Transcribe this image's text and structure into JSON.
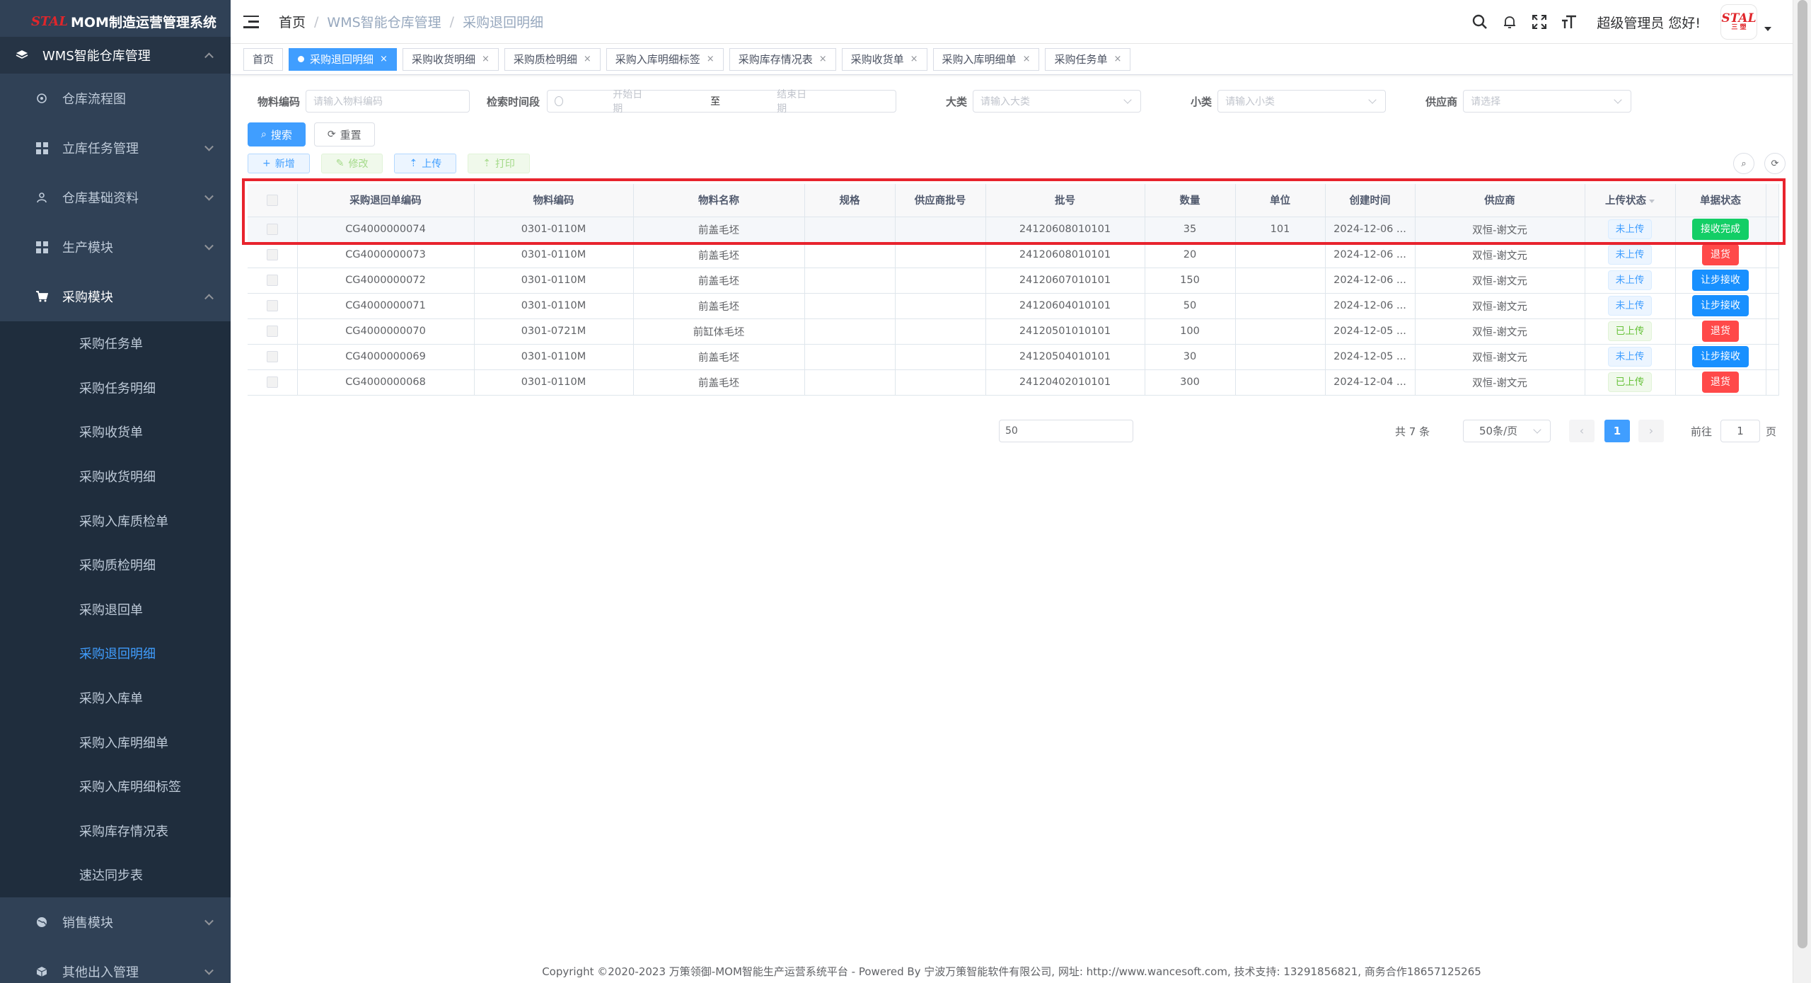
{
  "app": {
    "logo": "STAL",
    "title": "MOM制造运营管理系统"
  },
  "sidebar": {
    "top_group": "WMS智能仓库管理",
    "groups": [
      {
        "label": "仓库流程图"
      },
      {
        "label": "立库任务管理"
      },
      {
        "label": "仓库基础资料"
      },
      {
        "label": "生产模块"
      },
      {
        "label": "采购模块"
      }
    ],
    "purchase_items": [
      {
        "label": "采购任务单"
      },
      {
        "label": "采购任务明细"
      },
      {
        "label": "采购收货单"
      },
      {
        "label": "采购收货明细"
      },
      {
        "label": "采购入库质检单"
      },
      {
        "label": "采购质检明细"
      },
      {
        "label": "采购退回单"
      },
      {
        "label": "采购退回明细"
      },
      {
        "label": "采购入库单"
      },
      {
        "label": "采购入库明细单"
      },
      {
        "label": "采购入库明细标签"
      },
      {
        "label": "采购库存情况表"
      },
      {
        "label": "速达同步表"
      }
    ],
    "bottom_groups": [
      {
        "label": "销售模块"
      },
      {
        "label": "其他出入管理"
      }
    ]
  },
  "navbar": {
    "breadcrumb": [
      "首页",
      "WMS智能仓库管理",
      "采购退回明细"
    ],
    "greeting": "超级管理员 您好!",
    "avatar_text": "STAL",
    "avatar_sub": "三 塑"
  },
  "tags": [
    {
      "label": "首页"
    },
    {
      "label": "采购退回明细"
    },
    {
      "label": "采购收货明细"
    },
    {
      "label": "采购质检明细"
    },
    {
      "label": "采购入库明细标签"
    },
    {
      "label": "采购库存情况表"
    },
    {
      "label": "采购收货单"
    },
    {
      "label": "采购入库明细单"
    },
    {
      "label": "采购任务单"
    }
  ],
  "filters": {
    "material_code": {
      "label": "物料编码",
      "placeholder": "请输入物料编码"
    },
    "time_range": {
      "label": "检索时间段",
      "start": "开始日期",
      "to": "至",
      "end": "结束日期"
    },
    "major": {
      "label": "大类",
      "placeholder": "请输入大类"
    },
    "minor": {
      "label": "小类",
      "placeholder": "请输入小类"
    },
    "supplier": {
      "label": "供应商",
      "placeholder": "请选择"
    }
  },
  "buttons": {
    "search": "搜索",
    "reset": "重置",
    "add": "新增",
    "edit": "修改",
    "upload": "上传",
    "print": "打印"
  },
  "table": {
    "headers": [
      "采购退回单编码",
      "物料编码",
      "物料名称",
      "规格",
      "供应商批号",
      "批号",
      "数量",
      "单位",
      "创建时间",
      "供应商",
      "上传状态",
      "单据状态"
    ],
    "rows": [
      {
        "code": "CG4000000074",
        "material": "0301-0110M",
        "name": "前盖毛坯",
        "spec": "",
        "supplier_batch": "",
        "batch": "24120608010101",
        "qty": "35",
        "unit": "101",
        "created": "2024-12-06 ...",
        "supplier": "双恒-谢文元",
        "upload": "未上传",
        "status": "接收完成",
        "status_type": "green"
      },
      {
        "code": "CG4000000073",
        "material": "0301-0110M",
        "name": "前盖毛坯",
        "spec": "",
        "supplier_batch": "",
        "batch": "24120608010101",
        "qty": "20",
        "unit": "",
        "created": "2024-12-06 ...",
        "supplier": "双恒-谢文元",
        "upload": "未上传",
        "status": "退货",
        "status_type": "red"
      },
      {
        "code": "CG4000000072",
        "material": "0301-0110M",
        "name": "前盖毛坯",
        "spec": "",
        "supplier_batch": "",
        "batch": "24120607010101",
        "qty": "150",
        "unit": "",
        "created": "2024-12-06 ...",
        "supplier": "双恒-谢文元",
        "upload": "未上传",
        "status": "让步接收",
        "status_type": "blue"
      },
      {
        "code": "CG4000000071",
        "material": "0301-0110M",
        "name": "前盖毛坯",
        "spec": "",
        "supplier_batch": "",
        "batch": "24120604010101",
        "qty": "50",
        "unit": "",
        "created": "2024-12-06 ...",
        "supplier": "双恒-谢文元",
        "upload": "未上传",
        "status": "让步接收",
        "status_type": "blue"
      },
      {
        "code": "CG4000000070",
        "material": "0301-0721M",
        "name": "前缸体毛坯",
        "spec": "",
        "supplier_batch": "",
        "batch": "24120501010101",
        "qty": "100",
        "unit": "",
        "created": "2024-12-05 ...",
        "supplier": "双恒-谢文元",
        "upload": "已上传",
        "status": "退货",
        "status_type": "red"
      },
      {
        "code": "CG4000000069",
        "material": "0301-0110M",
        "name": "前盖毛坯",
        "spec": "",
        "supplier_batch": "",
        "batch": "24120504010101",
        "qty": "30",
        "unit": "",
        "created": "2024-12-05 ...",
        "supplier": "双恒-谢文元",
        "upload": "未上传",
        "status": "让步接收",
        "status_type": "blue"
      },
      {
        "code": "CG4000000068",
        "material": "0301-0110M",
        "name": "前盖毛坯",
        "spec": "",
        "supplier_batch": "",
        "batch": "24120402010101",
        "qty": "300",
        "unit": "",
        "created": "2024-12-04 ...",
        "supplier": "双恒-谢文元",
        "upload": "已上传",
        "status": "退货",
        "status_type": "red"
      }
    ]
  },
  "pager": {
    "input_value": "50",
    "total": "共 7 条",
    "size": "50条/页",
    "current": "1",
    "goto": "前往",
    "jump": "1",
    "page": "页"
  },
  "footer": "Copyright ©2020-2023 万策领御-MOM智能生产运营系统平台 - Powered By 宁波万策智能软件有限公司, 网址: http://www.wancesoft.com, 技术支持: 13291856821, 商务合作18657125265",
  "colors": {
    "sidebar_bg": "#304156",
    "primary": "#409eff",
    "highlight_box": "#e8232d"
  }
}
